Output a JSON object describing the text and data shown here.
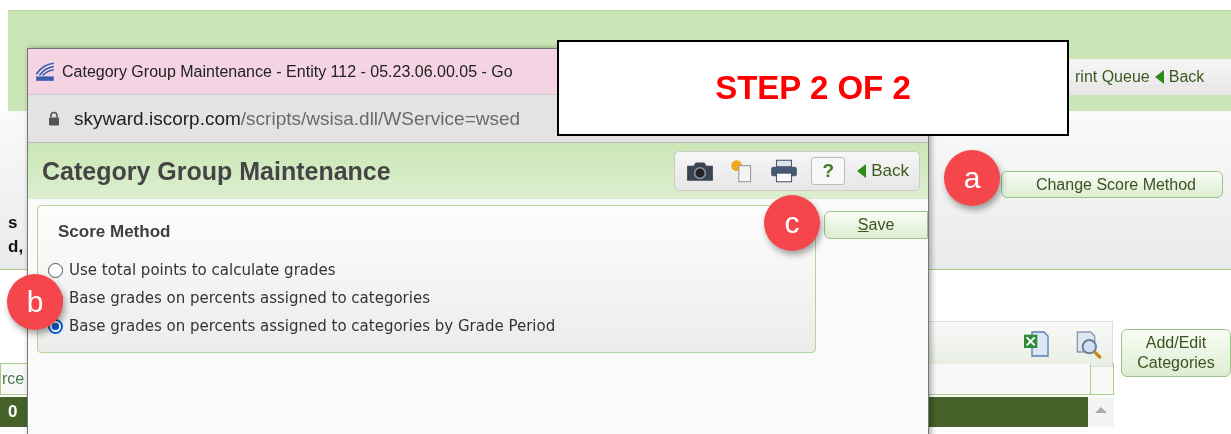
{
  "background_page": {
    "toolbar_links": [
      {
        "kind": "text",
        "label": "rint Queue"
      },
      {
        "kind": "back",
        "label": "Back"
      }
    ],
    "edge_texts": [
      "s",
      "d,"
    ],
    "change_score_button": "Change Score Method",
    "add_edit_button": "Add/Edit Categories",
    "table": {
      "header_cell": "rce",
      "row_cell": "0"
    }
  },
  "popup": {
    "title": "Category Group Maintenance - Entity 112 - 05.23.06.00.05 - Go",
    "url_host": "skyward.iscorp.com",
    "url_path": "/scripts/wsisa.dll/WService=wsed",
    "heading": "Category Group Maintenance",
    "help": "?",
    "back": "Back",
    "score_method": {
      "legend": "Score Method",
      "options": [
        {
          "label": "Use total points to calculate grades",
          "selected": false
        },
        {
          "label": "Base grades on percents assigned to categories",
          "selected": false
        },
        {
          "label": "Base grades on percents assigned to categories by Grade Period",
          "selected": true
        }
      ]
    },
    "save": "Save"
  },
  "step_banner": "STEP 2 OF 2",
  "callouts": [
    {
      "letter": "a",
      "kind": "a"
    },
    {
      "letter": "b",
      "kind": "b"
    },
    {
      "letter": "c",
      "kind": "c"
    }
  ]
}
